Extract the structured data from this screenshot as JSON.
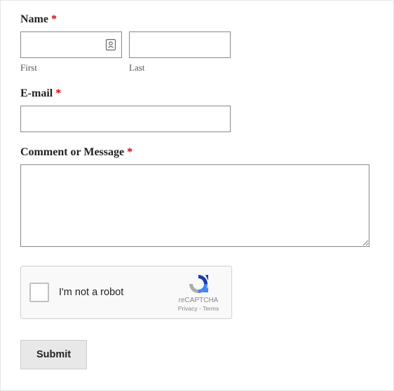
{
  "fields": {
    "name": {
      "label": "Name",
      "required": "*",
      "first_sublabel": "First",
      "last_sublabel": "Last"
    },
    "email": {
      "label": "E-mail",
      "required": "*"
    },
    "message": {
      "label": "Comment or Message",
      "required": "*"
    }
  },
  "recaptcha": {
    "label": "I'm not a robot",
    "brand": "reCAPTCHA",
    "links": "Privacy - Terms"
  },
  "submit": {
    "label": "Submit"
  }
}
